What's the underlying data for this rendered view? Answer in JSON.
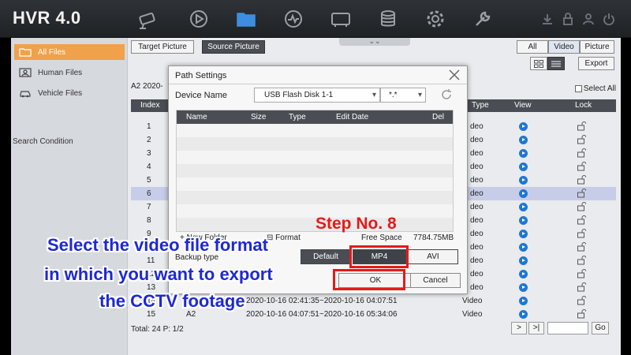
{
  "app": {
    "title": "HVR 4.0"
  },
  "nav": {
    "icons": [
      "camera-icon",
      "playback-icon",
      "file-folder-icon",
      "analytics-icon",
      "device-icon",
      "storage-icon",
      "settings-icon",
      "maintenance-icon"
    ],
    "active": "file-folder-icon",
    "accent": "#3c8fe0"
  },
  "sidebar": {
    "items": [
      {
        "label": "All Files",
        "active": true
      },
      {
        "label": "Human Files",
        "active": false
      },
      {
        "label": "Vehicle Files",
        "active": false
      }
    ],
    "search_condition": "Search Condition",
    "active_color": "#f0a14a"
  },
  "toolbar": {
    "target_picture": "Target Picture",
    "source_picture": "Source Picture",
    "all": "All",
    "video": "Video",
    "picture": "Picture",
    "export": "Export"
  },
  "file_list": {
    "range_label": "A2 2020-",
    "select_all": "Select All",
    "columns": {
      "index": "Index",
      "type": "Type",
      "view": "View",
      "lock": "Lock"
    },
    "rows": [
      {
        "index": "1",
        "type": "deo"
      },
      {
        "index": "2",
        "type": "deo"
      },
      {
        "index": "3",
        "type": "deo"
      },
      {
        "index": "4",
        "type": "deo"
      },
      {
        "index": "5",
        "type": "deo"
      },
      {
        "index": "6",
        "type": "deo"
      },
      {
        "index": "7",
        "type": "deo"
      },
      {
        "index": "8",
        "type": "deo"
      },
      {
        "index": "9",
        "type": "deo"
      },
      {
        "index": "10",
        "type": "deo"
      },
      {
        "index": "11",
        "type": "deo"
      },
      {
        "index": "12",
        "type": "deo"
      },
      {
        "index": "13",
        "type": "deo"
      },
      {
        "index": "14",
        "camera": "A2",
        "time": "2020-10-16 02:41:35~2020-10-16 04:07:51",
        "type": "Video"
      },
      {
        "index": "15",
        "camera": "A2",
        "time": "2020-10-16 04:07:51~2020-10-16 05:34:06",
        "type": "Video"
      }
    ],
    "highlighted_index": "6",
    "highlight_color": "#c7cde8"
  },
  "footer": {
    "total": "Total: 24  P: 1/2",
    "next": ">",
    "last": ">|",
    "go": "Go"
  },
  "dialog": {
    "title": "Path Settings",
    "device_name_label": "Device Name",
    "device_name_value": "USB Flash Disk 1-1",
    "device_filter_value": "*.*",
    "columns": [
      "Name",
      "Size",
      "Type",
      "Edit Date",
      "Del"
    ],
    "new_folder": "New Folder",
    "format": "Format",
    "free_space_label": "Free Space",
    "free_space_value": "7784.75MB",
    "backup_type_label": "Backup type",
    "backup_types": [
      "Default",
      "MP4",
      "AVI"
    ],
    "selected_backup_type": "MP4",
    "ok": "OK",
    "cancel": "Cancel"
  },
  "overlay": {
    "step": "Step No. 8",
    "caption_lines": [
      "Select the video file format",
      "in which you want to export",
      "the CCTV footage"
    ],
    "step_color": "#e41a1a",
    "caption_color": "#1d28d8"
  }
}
